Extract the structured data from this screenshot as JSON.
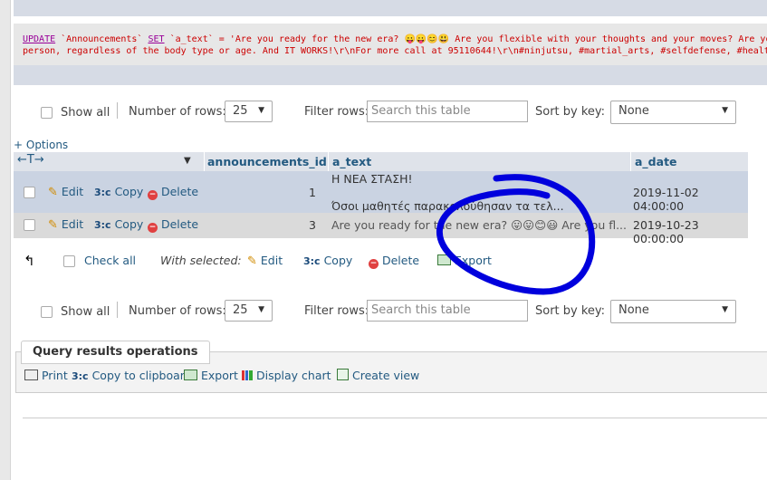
{
  "sql": {
    "line1_kw1": "UPDATE",
    "line1_tbl": " `Announcements` ",
    "line1_kw2": "SET",
    "line1_rest": " `a_text` = 'Are you ready for the new era? 😛😛😊😃 Are you flexible with your thoughts and your moves? Are you",
    "line2": "person, regardless of the body type or age. And IT WORKS!\\r\\nFor more call at 95110644!\\r\\n#ninjutsu, #martial_arts, #selfdefense, #health, #"
  },
  "nav": {
    "show_all": "Show all",
    "rows_label": "Number of rows:",
    "rows_value": "25",
    "filter_label": "Filter rows:",
    "filter_placeholder": "Search this table",
    "sort_label": "Sort by key:",
    "sort_value": "None"
  },
  "options_link": "+ Options",
  "table": {
    "arrows": "←T→",
    "columns": [
      "announcements_id",
      "a_text",
      "a_date"
    ],
    "rows": [
      {
        "id": "1",
        "text_line1": "Η ΝΕΑ ΣΤΑΣΗ!",
        "text_line2": "Όσοι μαθητές παρακολούθησαν τα τελ...",
        "date": "2019-11-02 04:00:00"
      },
      {
        "id": "3",
        "text_line1": "Are you ready for the new era? 😛😛😊😃 Are you fl...",
        "date": "2019-10-23 00:00:00"
      }
    ],
    "edit": "Edit",
    "copy": "Copy",
    "delete": "Delete"
  },
  "with_selected": {
    "check_all": "Check all",
    "label": "With selected:",
    "edit": "Edit",
    "copy": "Copy",
    "delete": "Delete",
    "export": "Export"
  },
  "qro": {
    "title": "Query results operations",
    "print": "Print",
    "copy_clipboard": "Copy to clipboard",
    "export": "Export",
    "display_chart": "Display chart",
    "create_view": "Create view"
  },
  "colors": {
    "link": "#235a81",
    "selected_row": "#cad3e2",
    "annotation": "#0000dd"
  },
  "icons": {
    "pencil": "✎",
    "copy": "3⃞",
    "delete": "−",
    "check_arrow": "↰"
  }
}
